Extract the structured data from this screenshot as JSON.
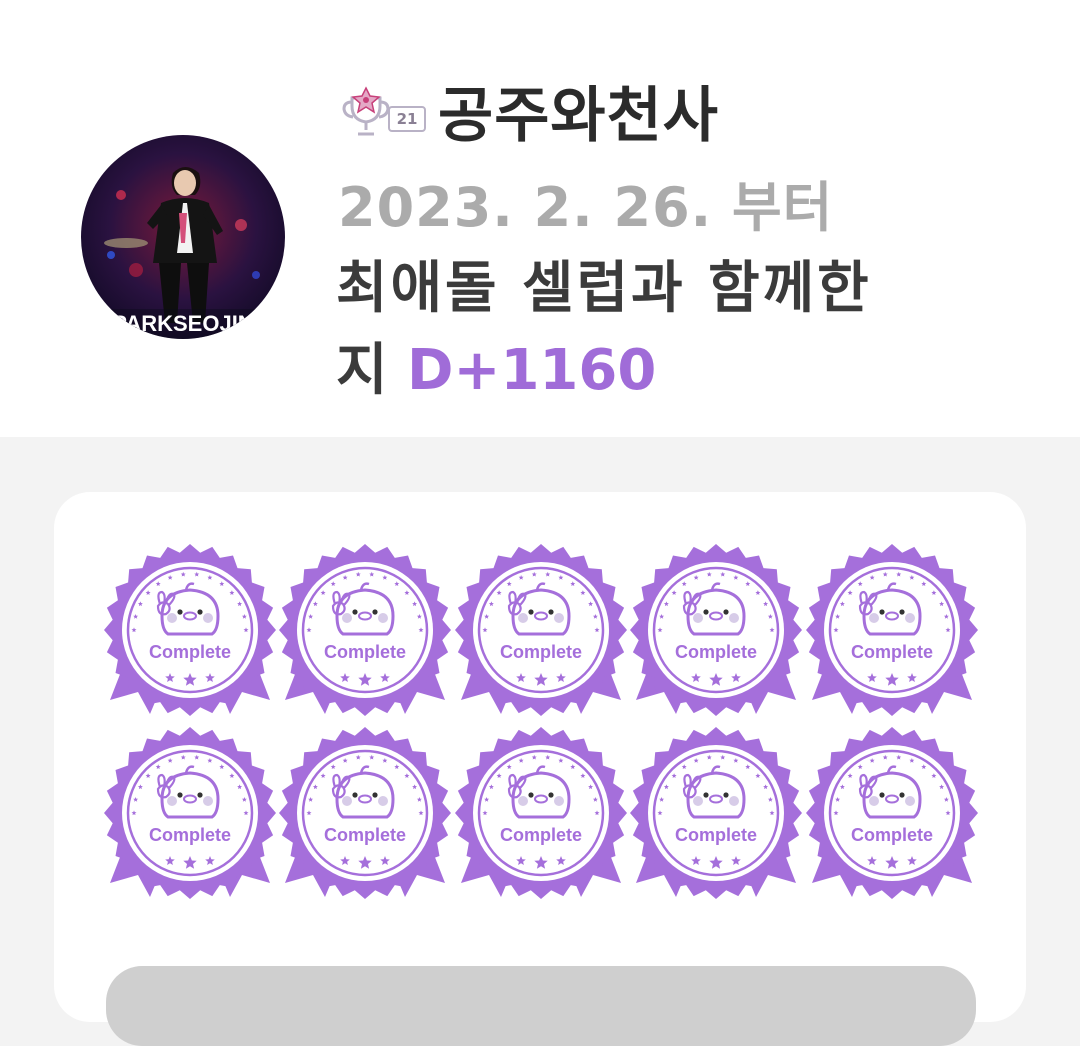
{
  "profile": {
    "level": "21",
    "nickname": "공주와천사",
    "since": "2023. 2. 26. 부터",
    "celeb_text": "최애돌 셀럽과 함께한",
    "dday_prefix": "지",
    "dday_value": "D+1160",
    "avatar_caption": "PARKSEOJIN"
  },
  "badges": {
    "items": [
      {
        "label": "Complete"
      },
      {
        "label": "Complete"
      },
      {
        "label": "Complete"
      },
      {
        "label": "Complete"
      },
      {
        "label": "Complete"
      },
      {
        "label": "Complete"
      },
      {
        "label": "Complete"
      },
      {
        "label": "Complete"
      },
      {
        "label": "Complete"
      },
      {
        "label": "Complete"
      }
    ],
    "color": "#a56fdb"
  },
  "colors": {
    "accent": "#a06cd8",
    "muted": "#ababab",
    "text": "#3b3b3b"
  }
}
